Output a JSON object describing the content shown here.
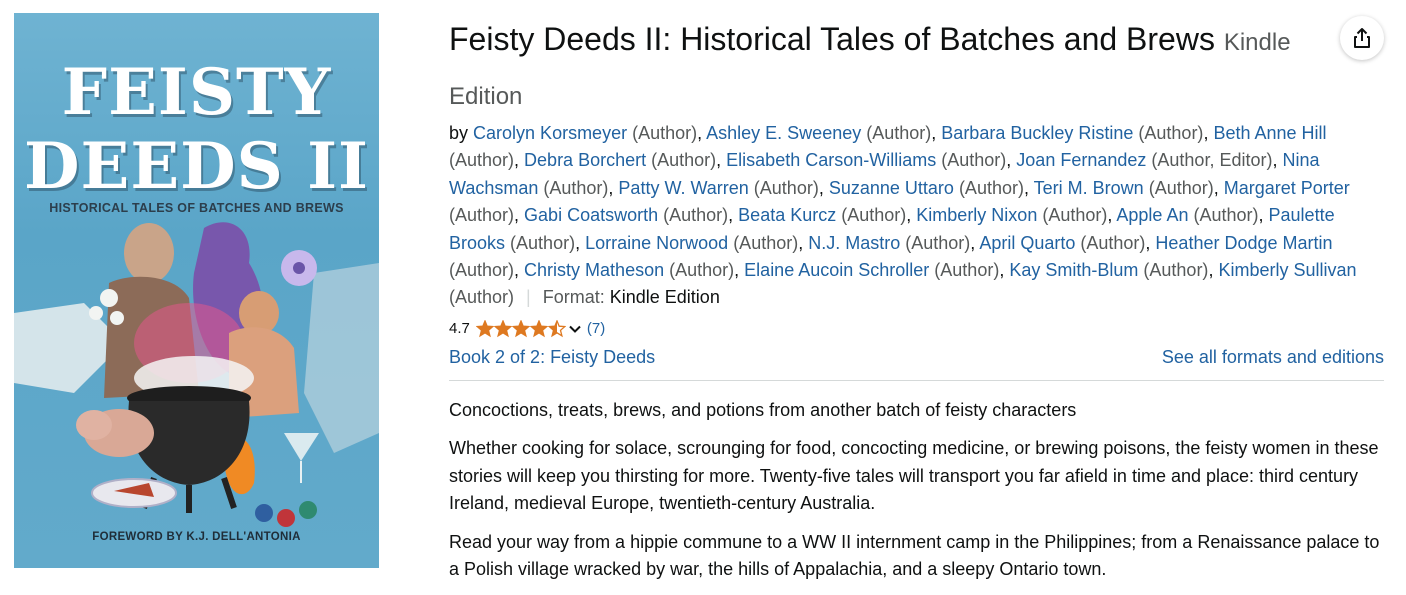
{
  "cover": {
    "title_line1": "FEISTY",
    "title_line2": "DEEDS II",
    "subtitle": "HISTORICAL TALES OF BATCHES AND BREWS",
    "foreword": "FOREWORD BY K.J. DELL'ANTONIA"
  },
  "product": {
    "title": "Feisty Deeds II: Historical Tales of Batches and Brews",
    "edition": "Kindle Edition",
    "share_icon": "share-icon",
    "by_label": "by",
    "authors": [
      {
        "name": "Carolyn Korsmeyer",
        "role": "(Author)"
      },
      {
        "name": "Ashley E. Sweeney",
        "role": "(Author)"
      },
      {
        "name": "Barbara Buckley Ristine",
        "role": "(Author)"
      },
      {
        "name": "Beth Anne Hill",
        "role": "(Author)"
      },
      {
        "name": "Debra Borchert",
        "role": "(Author)"
      },
      {
        "name": "Elisabeth Carson-Williams",
        "role": "(Author)"
      },
      {
        "name": "Joan Fernandez",
        "role": "(Author, Editor)"
      },
      {
        "name": "Nina Wachsman",
        "role": "(Author)"
      },
      {
        "name": "Patty W. Warren",
        "role": "(Author)"
      },
      {
        "name": "Suzanne Uttaro",
        "role": "(Author)"
      },
      {
        "name": "Teri M. Brown",
        "role": "(Author)"
      },
      {
        "name": "Margaret Porter",
        "role": "(Author)"
      },
      {
        "name": "Gabi Coatsworth",
        "role": "(Author)"
      },
      {
        "name": "Beata Kurcz",
        "role": "(Author)"
      },
      {
        "name": "Kimberly Nixon",
        "role": "(Author)"
      },
      {
        "name": "Apple An",
        "role": "(Author)"
      },
      {
        "name": "Paulette Brooks",
        "role": "(Author)"
      },
      {
        "name": "Lorraine Norwood",
        "role": "(Author)"
      },
      {
        "name": "N.J. Mastro",
        "role": "(Author)"
      },
      {
        "name": "April Quarto",
        "role": "(Author)"
      },
      {
        "name": "Heather Dodge Martin",
        "role": "(Author)"
      },
      {
        "name": "Christy Matheson",
        "role": "(Author)"
      },
      {
        "name": "Elaine Aucoin Schroller",
        "role": "(Author)"
      },
      {
        "name": "Kay Smith-Blum",
        "role": "(Author)"
      },
      {
        "name": "Kimberly Sullivan",
        "role": "(Author)"
      }
    ],
    "format_label": "Format:",
    "format_value": "Kindle Edition",
    "rating": {
      "value": "4.7",
      "stars": 4.5,
      "count": "(7)",
      "star_color": "#de7921",
      "dropdown_icon": "chevron-down-icon"
    },
    "series_link": "Book 2 of 2: Feisty Deeds",
    "formats_link": "See all formats and editions",
    "description": [
      "Concoctions, treats, brews, and potions from another batch of feisty characters",
      "Whether cooking for solace, scrounging for food, concocting medicine, or brewing poisons, the feisty women in these stories will keep you thirsting for more. Twenty-five tales will transport you far afield in time and place: third century Ireland, medieval Europe, twentieth-century Australia.",
      "Read your way from a hippie commune to a WW II internment camp in the Philippines; from a Renaissance palace to a Polish village wracked by war, the hills of Appalachia, and a sleepy Ontario town."
    ]
  },
  "colors": {
    "link": "#2162a1",
    "text": "#0f1111",
    "muted": "#565959",
    "divider": "#d5d9d9"
  }
}
